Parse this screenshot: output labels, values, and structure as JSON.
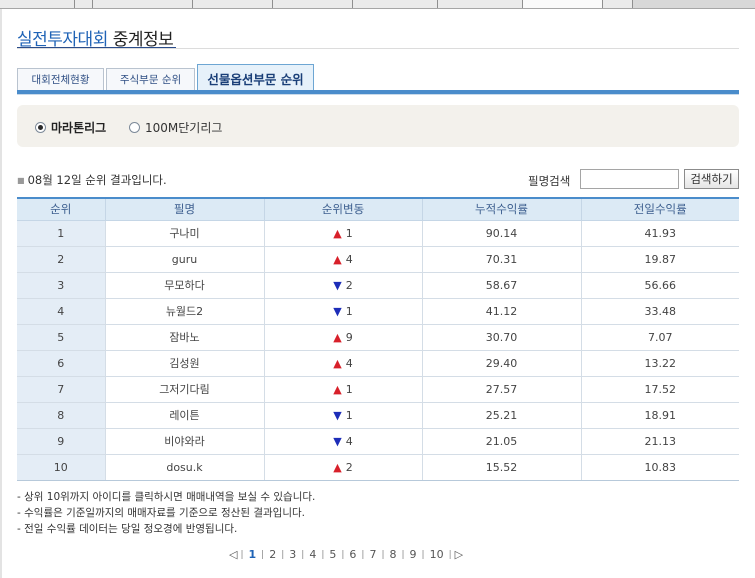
{
  "header": {
    "title_part1": "실전투자대회",
    "title_part2": " 중계정보"
  },
  "tabs": [
    {
      "label": "대회전체현황",
      "active": false
    },
    {
      "label": "주식부문 순위",
      "active": false
    },
    {
      "label": "선물옵션부문 순위",
      "active": true
    }
  ],
  "leagues": [
    {
      "label": "마라톤리그",
      "selected": true
    },
    {
      "label": "100M단기리그",
      "selected": false
    }
  ],
  "result": {
    "bullet": "■",
    "text": "08월 12일 순위 결과입니다."
  },
  "search": {
    "label": "필명검색",
    "value": "",
    "button_label": "검색하기"
  },
  "table": {
    "columns": [
      "순위",
      "필명",
      "순위변동",
      "누적수익률",
      "전일수익률"
    ],
    "rows": [
      {
        "rank": "1",
        "name": "구나미",
        "dir": "up",
        "arrow": "▲",
        "change": "1",
        "cum": "90.14",
        "prev": "41.93"
      },
      {
        "rank": "2",
        "name": "guru",
        "dir": "up",
        "arrow": "▲",
        "change": "4",
        "cum": "70.31",
        "prev": "19.87"
      },
      {
        "rank": "3",
        "name": "무모하다",
        "dir": "down",
        "arrow": "▼",
        "change": "2",
        "cum": "58.67",
        "prev": "56.66"
      },
      {
        "rank": "4",
        "name": "뉴월드2",
        "dir": "down",
        "arrow": "▼",
        "change": "1",
        "cum": "41.12",
        "prev": "33.48"
      },
      {
        "rank": "5",
        "name": "잠바노",
        "dir": "up",
        "arrow": "▲",
        "change": "9",
        "cum": "30.70",
        "prev": "7.07"
      },
      {
        "rank": "6",
        "name": "김성원",
        "dir": "up",
        "arrow": "▲",
        "change": "4",
        "cum": "29.40",
        "prev": "13.22"
      },
      {
        "rank": "7",
        "name": "그저기다림",
        "dir": "up",
        "arrow": "▲",
        "change": "1",
        "cum": "27.57",
        "prev": "17.52"
      },
      {
        "rank": "8",
        "name": "레이튼",
        "dir": "down",
        "arrow": "▼",
        "change": "1",
        "cum": "25.21",
        "prev": "18.91"
      },
      {
        "rank": "9",
        "name": "비야와라",
        "dir": "down",
        "arrow": "▼",
        "change": "4",
        "cum": "21.05",
        "prev": "21.13"
      },
      {
        "rank": "10",
        "name": "dosu.k",
        "dir": "up",
        "arrow": "▲",
        "change": "2",
        "cum": "15.52",
        "prev": "10.83"
      }
    ]
  },
  "notes": [
    "- 상위 10위까지 아이디를 클릭하시면 매매내역을 보실 수 있습니다.",
    "- 수익률은 기준일까지의 매매자료를 기준으로 정산된 결과입니다.",
    "- 전일 수익률 데이터는 당일 정오경에 반영됩니다."
  ],
  "pagination": {
    "prev_icon": "◁",
    "next_icon": "▷",
    "separator": "|",
    "current": "1",
    "pages": [
      "1",
      "2",
      "3",
      "4",
      "5",
      "6",
      "7",
      "8",
      "9",
      "10"
    ]
  },
  "colors": {
    "accent": "#4a8ccb",
    "up": "#d8202a",
    "down": "#1d2db8",
    "title_blue": "#1f63b6"
  }
}
